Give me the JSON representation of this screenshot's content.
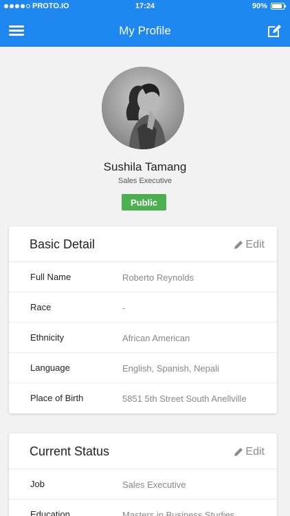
{
  "status_bar": {
    "carrier": "PROTO.IO",
    "time": "17:24",
    "battery": "90%",
    "battery_level": 0.9
  },
  "header": {
    "title": "My Profile",
    "menu_icon": "menu-icon",
    "edit_icon": "edit-icon",
    "color": "#1e88f0"
  },
  "profile": {
    "name": "Sushila Tamang",
    "role": "Sales Executive",
    "visibility": "Public",
    "badge_color": "#4caf50"
  },
  "basic_detail": {
    "title": "Basic Detail",
    "edit_label": "Edit",
    "rows": [
      {
        "label": "Full Name",
        "value": "Roberto Reynolds"
      },
      {
        "label": "Race",
        "value": "-"
      },
      {
        "label": "Ethnicity",
        "value": "African American"
      },
      {
        "label": "Language",
        "value": "English, Spanish, Nepali"
      },
      {
        "label": "Place of Birth",
        "value": "5851 5th Street South Anellville"
      }
    ]
  },
  "current_status": {
    "title": "Current Status",
    "edit_label": "Edit",
    "rows": [
      {
        "label": "Job",
        "value": "Sales Executive"
      },
      {
        "label": "Education",
        "value": "Masters in Business Studies"
      }
    ]
  }
}
